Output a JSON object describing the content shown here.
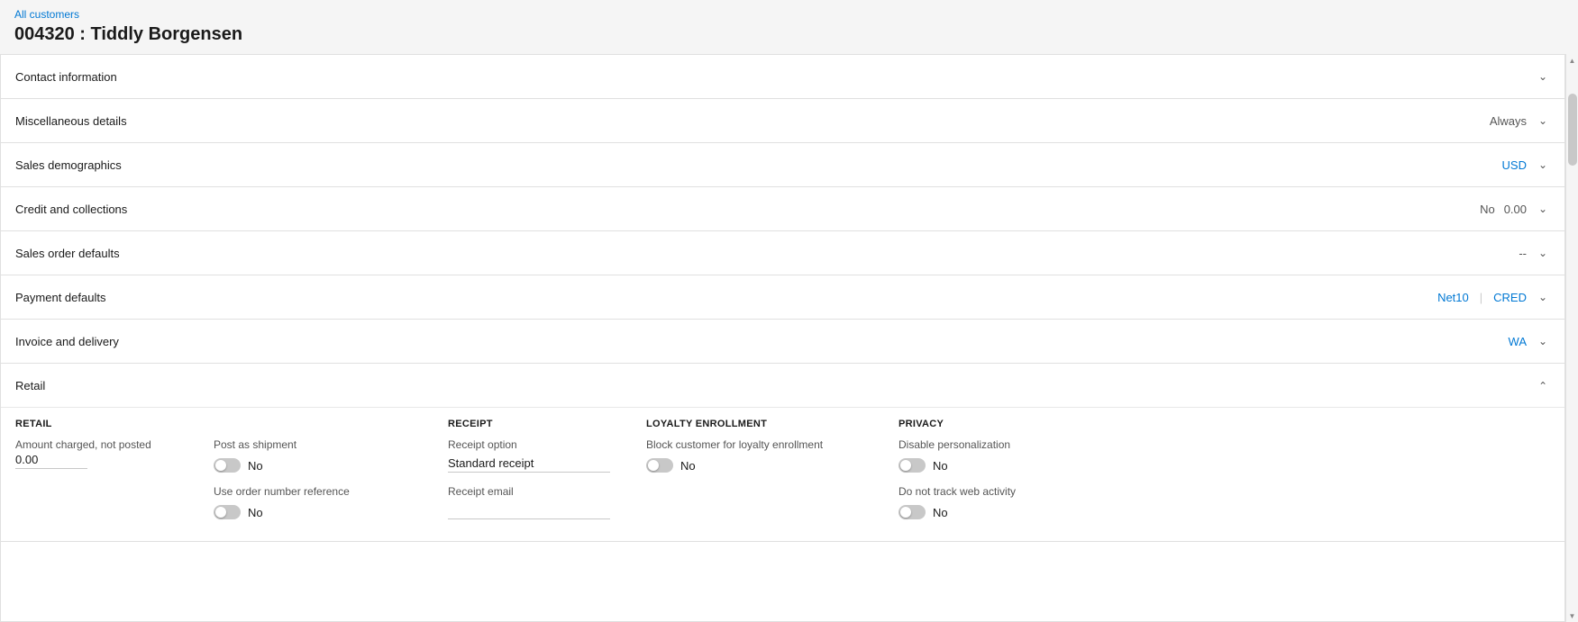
{
  "breadcrumb": {
    "link_label": "All customers"
  },
  "page": {
    "title": "004320 : Tiddly Borgensen"
  },
  "sections": [
    {
      "id": "contact-information",
      "label": "Contact information",
      "expanded": false,
      "right_values": [],
      "chevron": "down"
    },
    {
      "id": "miscellaneous-details",
      "label": "Miscellaneous details",
      "expanded": false,
      "right_values": [
        {
          "text": "Always",
          "blue": false
        }
      ],
      "chevron": "down"
    },
    {
      "id": "sales-demographics",
      "label": "Sales demographics",
      "expanded": false,
      "right_values": [
        {
          "text": "USD",
          "blue": true
        }
      ],
      "chevron": "down"
    },
    {
      "id": "credit-and-collections",
      "label": "Credit and collections",
      "expanded": false,
      "right_values": [
        {
          "text": "No",
          "blue": false
        },
        {
          "text": "0.00",
          "blue": false
        }
      ],
      "chevron": "down"
    },
    {
      "id": "sales-order-defaults",
      "label": "Sales order defaults",
      "expanded": false,
      "right_values": [
        {
          "text": "--",
          "blue": false
        }
      ],
      "chevron": "down"
    },
    {
      "id": "payment-defaults",
      "label": "Payment defaults",
      "expanded": false,
      "right_values": [
        {
          "text": "Net10",
          "blue": true
        },
        {
          "text": "|",
          "blue": false,
          "divider": true
        },
        {
          "text": "CRED",
          "blue": true
        }
      ],
      "chevron": "down"
    },
    {
      "id": "invoice-and-delivery",
      "label": "Invoice and delivery",
      "expanded": false,
      "right_values": [
        {
          "text": "WA",
          "blue": true
        }
      ],
      "chevron": "down"
    },
    {
      "id": "retail",
      "label": "Retail",
      "expanded": true,
      "right_values": [],
      "chevron": "up"
    }
  ],
  "retail": {
    "col1": {
      "heading": "RETAIL",
      "field1_label": "Amount charged, not posted",
      "field1_value": "0.00"
    },
    "col2": {
      "heading": "",
      "toggle1_label": "Post as shipment",
      "toggle1_value": "No",
      "toggle1_on": false,
      "toggle2_label": "Use order number reference",
      "toggle2_value": "No",
      "toggle2_on": false
    },
    "col3": {
      "heading": "RECEIPT",
      "field1_label": "Receipt option",
      "field1_value": "Standard receipt",
      "field2_label": "Receipt email",
      "field2_value": ""
    },
    "col4": {
      "heading": "LOYALTY ENROLLMENT",
      "toggle1_label": "Block customer for loyalty enrollment",
      "toggle1_value": "No",
      "toggle1_on": false
    },
    "col5": {
      "heading": "PRIVACY",
      "toggle1_label": "Disable personalization",
      "toggle1_value": "No",
      "toggle1_on": false,
      "toggle2_label": "Do not track web activity",
      "toggle2_value": "No",
      "toggle2_on": false
    }
  }
}
